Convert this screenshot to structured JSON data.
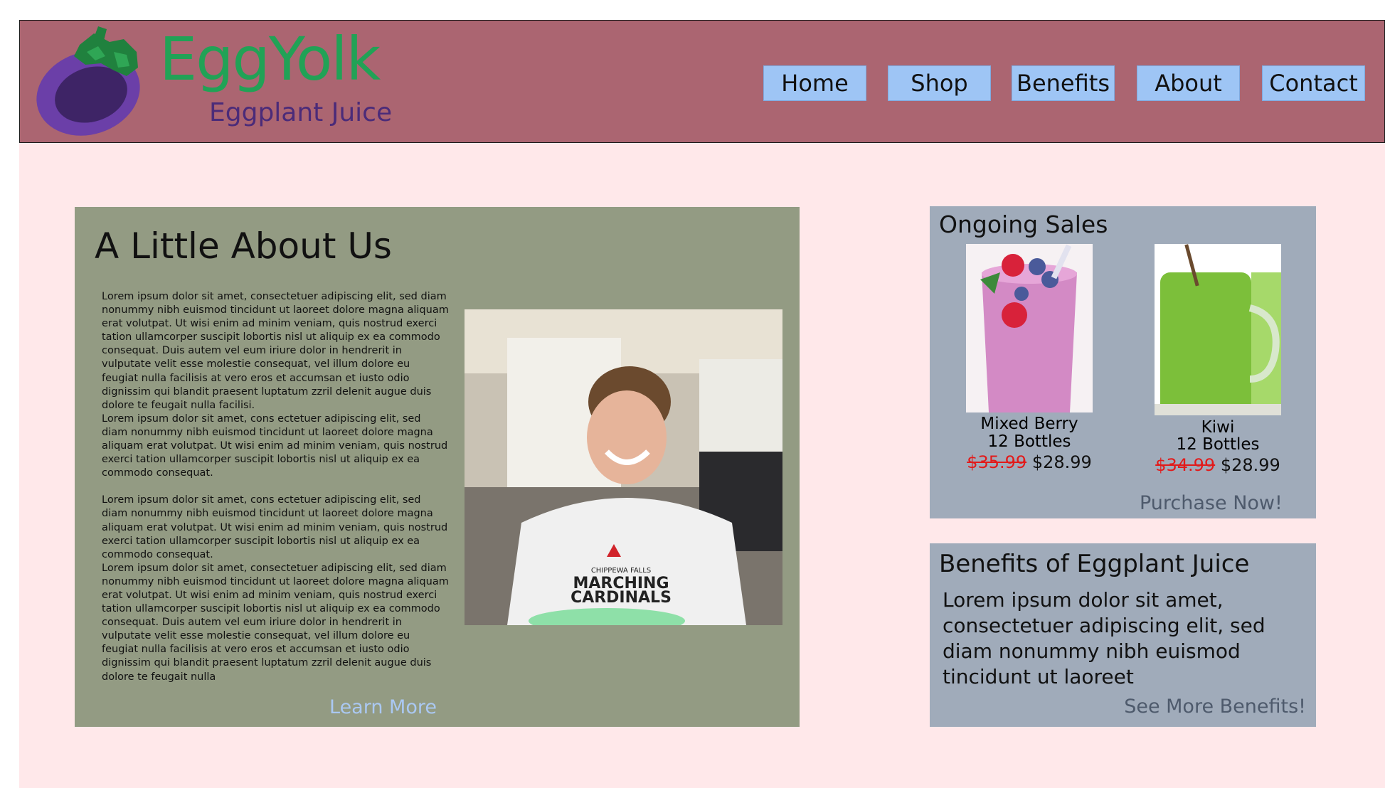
{
  "brand": {
    "name": "EggYolk",
    "subtitle": "Eggplant Juice"
  },
  "nav": [
    {
      "label": "Home"
    },
    {
      "label": "Shop"
    },
    {
      "label": "Benefits"
    },
    {
      "label": "About"
    },
    {
      "label": "Contact"
    }
  ],
  "about": {
    "title": "A Little About Us",
    "paragraphs": [
      "Lorem ipsum dolor sit amet, consectetuer adipiscing elit, sed diam nonummy nibh euismod tincidunt ut laoreet dolore magna aliquam erat volutpat. Ut wisi enim ad minim veniam, quis nostrud exerci tation ullamcorper suscipit lobortis nisl ut aliquip ex ea commodo consequat. Duis autem vel eum iriure dolor in hendrerit in vulputate velit esse molestie consequat, vel illum dolore eu feugiat nulla facilisis at vero eros et accumsan et iusto odio dignissim qui blandit praesent luptatum zzril delenit augue duis dolore te feugait nulla facilisi.",
      "Lorem ipsum dolor sit amet, cons ectetuer adipiscing elit, sed diam nonummy nibh euismod tincidunt ut laoreet dolore magna aliquam erat volutpat. Ut wisi enim ad minim veniam, quis nostrud exerci tation ullamcorper suscipit lobortis nisl ut aliquip ex ea commodo consequat.",
      "Lorem ipsum dolor sit amet, cons ectetuer adipiscing elit, sed diam nonummy nibh euismod tincidunt ut laoreet dolore magna aliquam erat volutpat. Ut wisi enim ad minim veniam, quis nostrud exerci tation ullamcorper suscipit lobortis nisl ut aliquip ex ea commodo consequat.",
      "Lorem ipsum dolor sit amet, consectetuer adipiscing elit, sed diam nonummy nibh euismod tincidunt ut laoreet dolore magna aliquam erat volutpat. Ut wisi enim ad minim veniam, quis nostrud exerci tation ullamcorper suscipit lobortis nisl ut aliquip ex ea commodo consequat. Duis autem vel eum iriure dolor in hendrerit in vulputate velit esse molestie consequat, vel illum dolore eu feugiat nulla facilisis at vero eros et accumsan et iusto odio dignissim qui blandit praesent luptatum zzril delenit augue duis dolore te feugait nulla"
    ],
    "photo_shirt_line1": "CHIPPEWA FALLS",
    "photo_shirt_line2": "MARCHING",
    "photo_shirt_line3": "CARDINALS",
    "learn_more": "Learn More"
  },
  "sales": {
    "title": "Ongoing Sales",
    "products": [
      {
        "name": "Mixed Berry",
        "qty": "12 Bottles",
        "old_price": "$35.99",
        "new_price": "$28.99"
      },
      {
        "name": "Kiwi",
        "qty": "12 Bottles",
        "old_price": "$34.99",
        "new_price": "$28.99"
      }
    ],
    "cta": "Purchase Now!"
  },
  "benefits": {
    "title": "Benefits of Eggplant Juice",
    "body": "Lorem ipsum dolor sit amet, consectetuer adipiscing elit, sed diam nonummy nibh euismod tincidunt ut laoreet",
    "cta": "See More Benefits!"
  },
  "colors": {
    "header_bg": "#ab6571",
    "page_bg": "#ffe8ea",
    "nav_button": "#9ec5f5",
    "about_panel": "#939b83",
    "side_panel": "#a0abba",
    "brand_green": "#21a256",
    "brand_purple": "#4b2b79",
    "old_price_red": "#e21a1a"
  }
}
